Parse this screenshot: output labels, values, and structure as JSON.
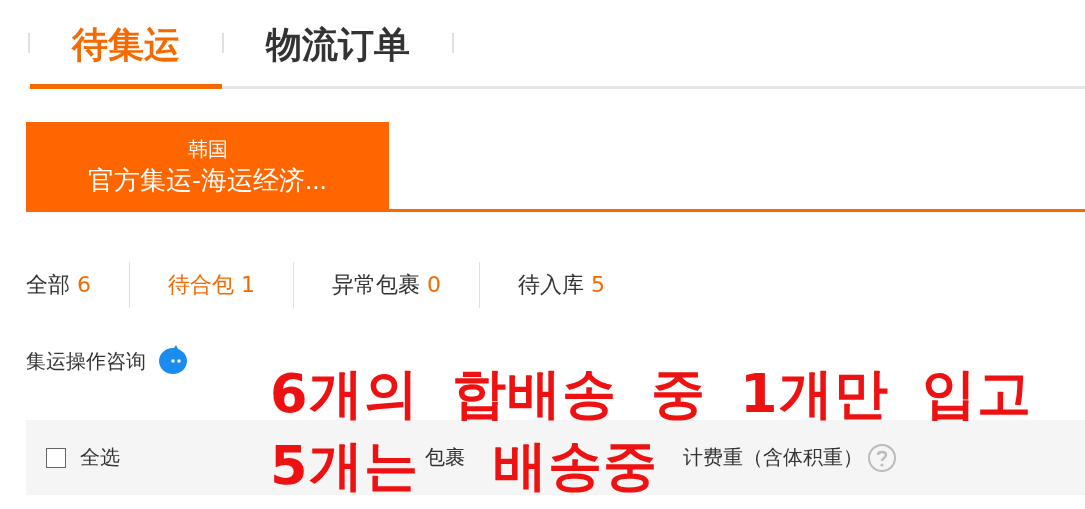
{
  "tabs": [
    {
      "label": "待集运",
      "selected": true
    },
    {
      "label": "物流订单",
      "selected": false
    }
  ],
  "routes": [
    {
      "country": "韩国",
      "name": "官方集运-海运经济...",
      "selected": true
    }
  ],
  "filters": [
    {
      "label": "全部",
      "count": "6",
      "selected": false
    },
    {
      "label": "待合包",
      "count": "1",
      "selected": true
    },
    {
      "label": "异常包裹",
      "count": "0",
      "selected": false
    },
    {
      "label": "待入库",
      "count": "5",
      "selected": false
    }
  ],
  "consult": {
    "label": "集运操作咨询"
  },
  "table": {
    "select_all": {
      "label": "全选",
      "checked": false
    },
    "columns": [
      "包裹",
      "计费重（含体积重）"
    ]
  },
  "annotation": [
    {
      "parts": [
        "6개의 합배송 중 1개만 입고"
      ]
    },
    {
      "parts": [
        "5개는",
        "배송중"
      ]
    }
  ]
}
